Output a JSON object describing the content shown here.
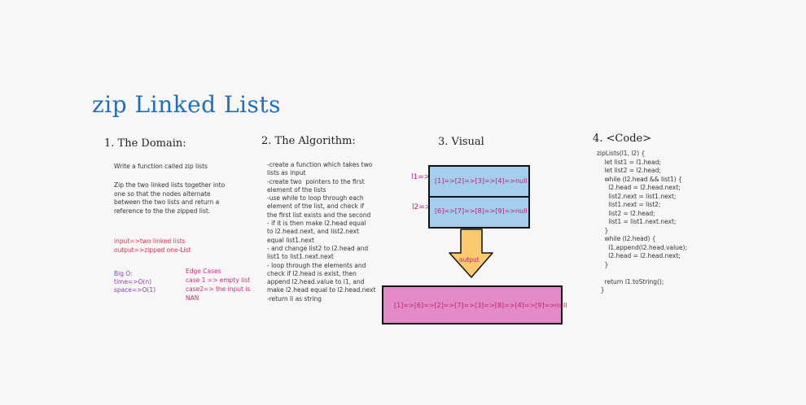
{
  "title": "zip Linked Lists",
  "domain": {
    "heading": "1. The Domain:",
    "intro": "Write a function called zip lists",
    "description": "Zip the two linked lists together into\none so that the nodes alternate\nbetween the two lists and return a\nreference to the the zipped list.",
    "input": "input=>two linked lists",
    "output": "output=>zipped one-List",
    "bigo_title": "Big O:",
    "time": "time=>O(n)",
    "space": "space=>O(1)",
    "edge_title": "Edge Cases",
    "edge_case1": "case 1 => empty list",
    "edge_case2": "case2=> the input is\nNAN"
  },
  "algorithm": {
    "heading": "2. The Algorithm:",
    "text": "-create a function which takes two\nlists as input\n-create two  pointers to the first\nelement of the lists\n-use while to loop through each\nelement of the list, and check if\nthe first list exists and the second\n- if it is then make l2.head equal\nto l2.head.next, and list2.next\nequal list1.next\n- and change list2 to l2.head and\nlist1 to list1.next.next\n- loop through the elements and\ncheck if l2.head is exist, then\nappend l2.head.value to l1, and\nmake l2.head equal to l2.head.next\n-return li as string"
  },
  "visual": {
    "heading": "3. Visual",
    "l1_label": "l1=>",
    "l1_list": "[1]=>[2]=>[3]=>[4]=>null",
    "l2_label": "l2=>",
    "l2_list": "[6]=>[7]=>[8]=>[9]=>null",
    "arrow_label": "output",
    "output_list": "[1]=>[6]=>[2]=>[7]=>[3]=>[8]=>[4]=>[9]=>null",
    "colors": {
      "box_fill": "#a5cdee",
      "arrow_fill": "#fcc96e",
      "output_fill": "#e58ac8",
      "list_text": "#c02070"
    }
  },
  "code": {
    "heading": "4. <Code>",
    "text": "zipLists(l1, l2) {\n    let list1 = l1.head;\n    let list2 = l2.head;\n    while (l2.head && list1) {\n      l2.head = l2.head.next;\n      list2.next = list1.next;\n      list1.next = list2;\n      list2 = l2.head;\n      list1 = list1.next.next;\n    }\n    while (l2.head) {\n      l1.append(l2.head.value);\n      l2.head = l2.head.next;\n    }\n\n    return l1.toString();\n  }"
  }
}
